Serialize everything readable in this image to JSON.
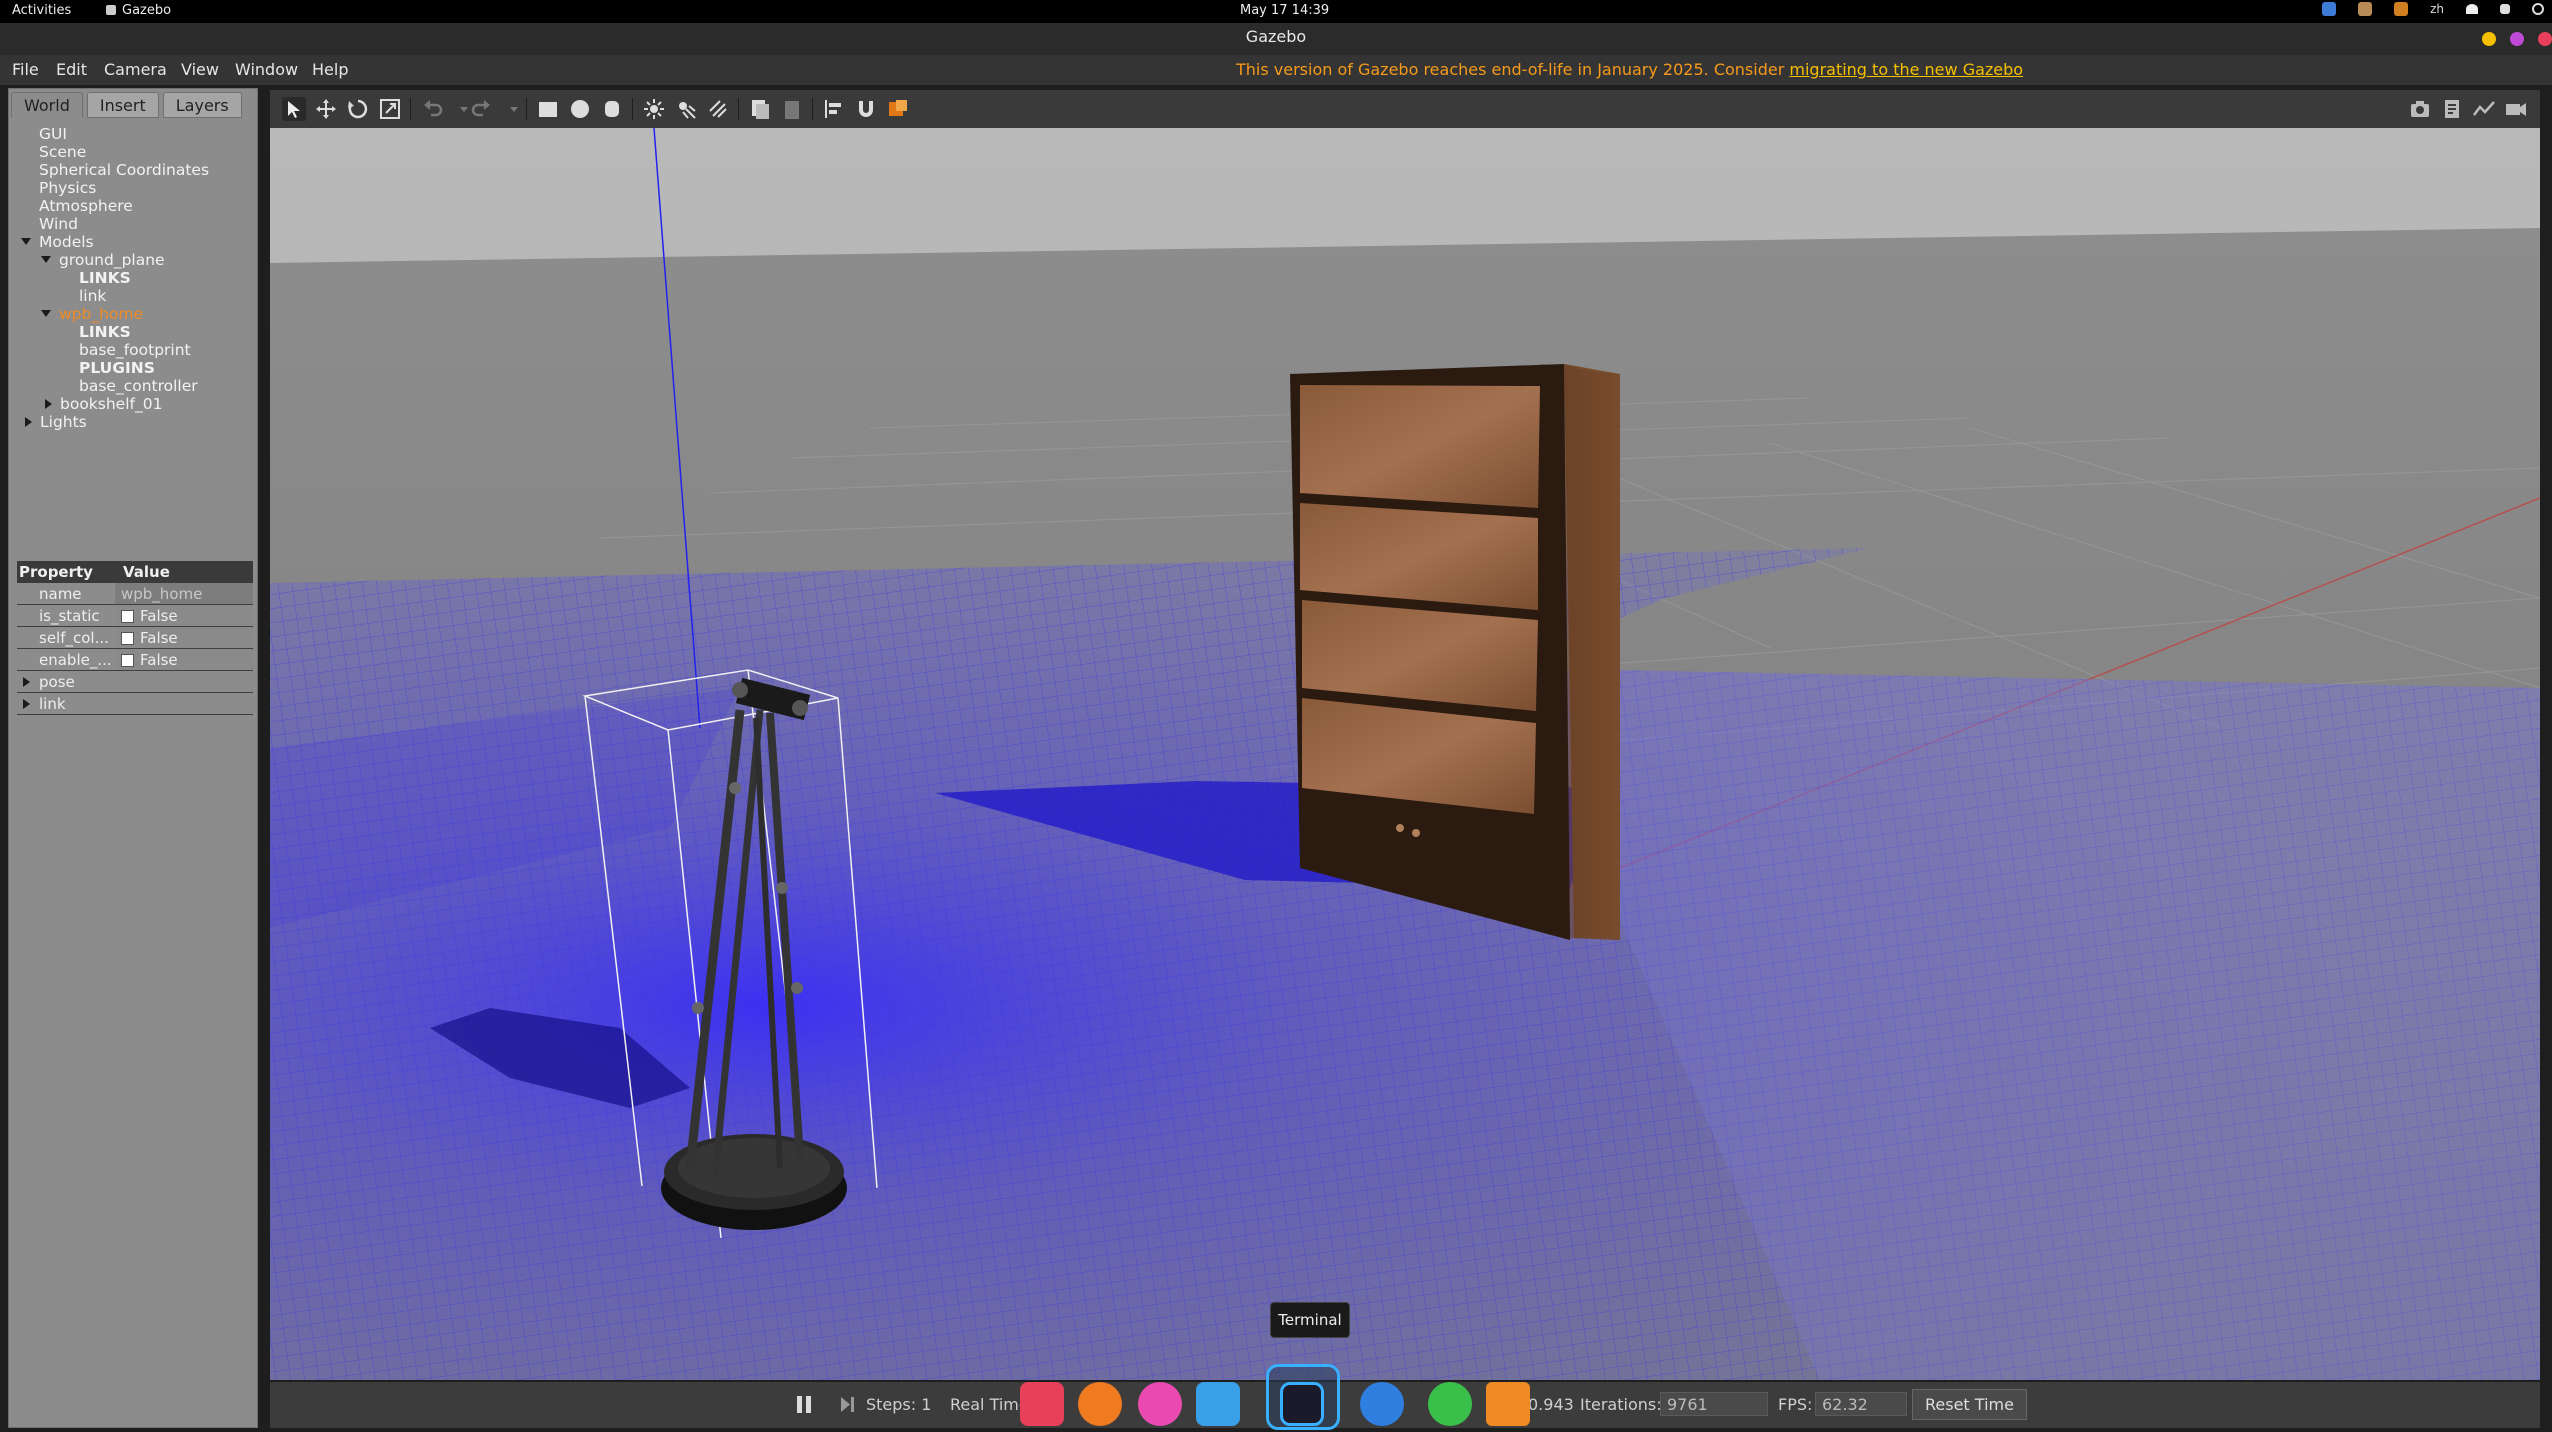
{
  "system_bar": {
    "activities": "Activities",
    "app_name": "Gazebo",
    "clock": "May 17  14:39",
    "input_method": "zh"
  },
  "window": {
    "title": "Gazebo"
  },
  "menu": {
    "file": "File",
    "edit": "Edit",
    "camera": "Camera",
    "view": "View",
    "window": "Window",
    "help": "Help",
    "notice_text": "This version of Gazebo reaches end-of-life in January 2025. Consider ",
    "notice_link": "migrating to the new Gazebo"
  },
  "left_panel": {
    "tabs": [
      "World",
      "Insert",
      "Layers"
    ],
    "tree": {
      "gui": "GUI",
      "scene": "Scene",
      "spherical": "Spherical Coordinates",
      "physics": "Physics",
      "atmosphere": "Atmosphere",
      "wind": "Wind",
      "models": "Models",
      "ground_plane": "ground_plane",
      "gp_links": "LINKS",
      "gp_link": "link",
      "wpb_home": "wpb_home",
      "wpb_links": "LINKS",
      "wpb_base_footprint": "base_footprint",
      "wpb_plugins": "PLUGINS",
      "wpb_base_controller": "base_controller",
      "bookshelf": "bookshelf_01",
      "lights": "Lights"
    },
    "properties": {
      "header_property": "Property",
      "header_value": "Value",
      "name_key": "name",
      "name_value": "wpb_home",
      "is_static_key": "is_static",
      "is_static_value": "False",
      "self_col_key": "self_col...",
      "self_col_value": "False",
      "enable_key": "enable_...",
      "enable_value": "False",
      "pose_key": "pose",
      "link_key": "link"
    }
  },
  "tooltip": "Terminal",
  "status": {
    "steps_label": "Steps: 1",
    "real_time_label": "Real Time",
    "real_time_value": "0.943",
    "iterations_label": "Iterations:",
    "iterations_value": "9761",
    "fps_label": "FPS:",
    "fps_value": "62.32",
    "reset_label": "Reset Time"
  },
  "colors": {
    "accent_orange": "#f08a24",
    "laser_blue": "#3b32e8",
    "dock_active": "#38b0ff"
  }
}
